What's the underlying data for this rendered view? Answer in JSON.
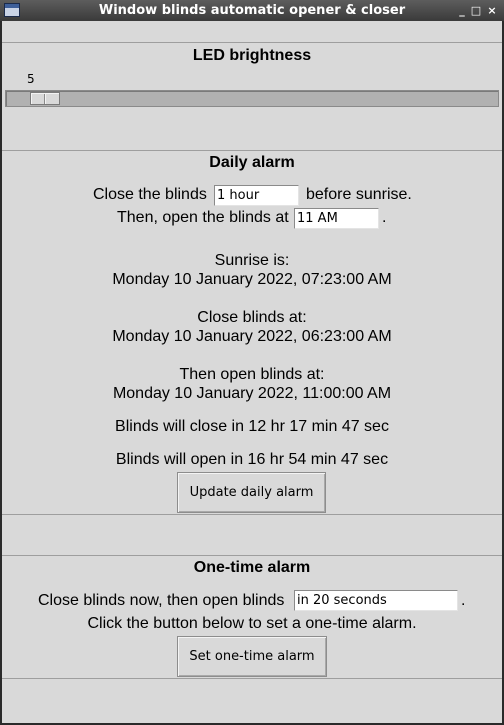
{
  "window": {
    "title": "Window blinds automatic opener & closer",
    "controls": [
      "_",
      "□",
      "×"
    ]
  },
  "led": {
    "heading": "LED brightness",
    "value": "5",
    "slider_fraction": 0.05
  },
  "daily": {
    "heading": "Daily alarm",
    "close_prefix": "Close the blinds",
    "close_value": "1 hour",
    "close_suffix": "before sunrise.",
    "open_prefix": "Then, open the blinds at",
    "open_value": "11 AM",
    "open_suffix": ".",
    "sunrise_label": "Sunrise is:",
    "sunrise_value": "Monday 10 January 2022, 07:23:00 AM",
    "close_at_label": "Close blinds at:",
    "close_at_value": "Monday 10 January 2022, 06:23:00 AM",
    "open_at_label": "Then open blinds at:",
    "open_at_value": "Monday 10 January 2022, 11:00:00 AM",
    "close_countdown": "Blinds will close in 12 hr 17 min 47 sec",
    "open_countdown": "Blinds will open in 16 hr 54 min 47 sec",
    "update_button": "Update daily alarm"
  },
  "onetime": {
    "heading": "One-time alarm",
    "prefix": "Close blinds now, then open blinds",
    "value": "in 20 seconds",
    "suffix": ".",
    "instruction": "Click the button below to set a one-time alarm.",
    "set_button": "Set one-time alarm"
  }
}
